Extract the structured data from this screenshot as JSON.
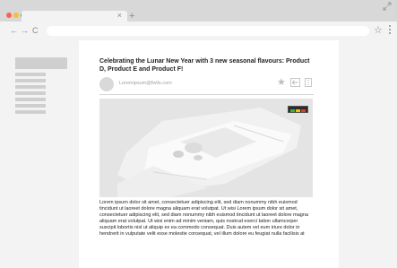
{
  "browser": {
    "tab_close": "×",
    "new_tab": "+",
    "nav": {
      "back": "←",
      "forward": "→",
      "reload": "C"
    },
    "bookmark_star": "☆",
    "traffic_lights": {
      "close_color": "#ff5f57",
      "minimize_color": "#febc2e",
      "maximize_color": "#28c840"
    }
  },
  "email": {
    "subject": "Celebrating the Lunar New Year with 3 new seasonal flavours: Product D, Product E and Product F!",
    "sender": "Loremipsum@fwllo.com",
    "star": "★",
    "body": "Lorem ipsum dolor sit amet, consectetuer adipiscing elit, sed diam nonummy nibh euismod tincidunt ut laoreet dolore magna aliquam erat volutpat. Ut wisi Lorem ipsum dolor sit amet, consectetuer adipiscing elit, sed diam nonummy nibh euismod tincidunt ut laoreet dolore magna aliquam erat volutpat. Ut wisi enim ad minim veniam, quis nostrud exerci tation ullamcorper suscipit lobortis nisl ut aliquip ex ea commodo consequat. Duis autem vel eum iriure dolor in hendrerit in vulputate velit esse molestie consequat, vel illum dolore eu feugiat nulla facilisis at"
  },
  "colors": {
    "chrome_bar": "#d8d8d8",
    "page_bg": "#f3f3f3",
    "placeholder_gray": "#cfcfcf"
  }
}
